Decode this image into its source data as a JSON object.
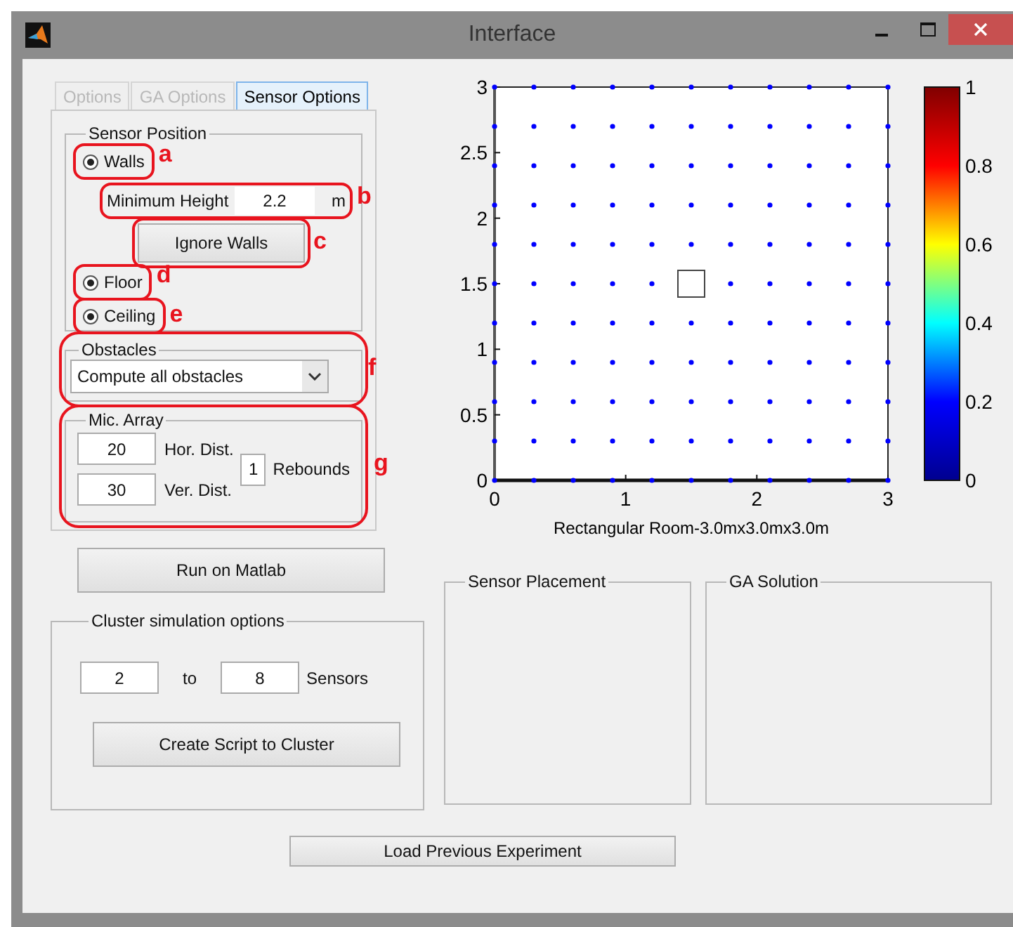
{
  "window": {
    "title": "Interface"
  },
  "tabs": [
    {
      "label": "Options",
      "selected": false,
      "disabled": true
    },
    {
      "label": "GA Options",
      "selected": false,
      "disabled": true
    },
    {
      "label": "Sensor Options",
      "selected": true,
      "disabled": false
    }
  ],
  "sensor_position": {
    "title": "Sensor Position",
    "walls": {
      "label": "Walls",
      "selected": true,
      "annotation": "a"
    },
    "minimum_height": {
      "label": "Minimum Height",
      "value": "2.2",
      "unit": "m",
      "annotation": "b"
    },
    "ignore_walls": {
      "label": "Ignore Walls",
      "annotation": "c"
    },
    "floor": {
      "label": "Floor",
      "selected": true,
      "annotation": "d"
    },
    "ceiling": {
      "label": "Ceiling",
      "selected": true,
      "annotation": "e"
    }
  },
  "obstacles": {
    "title": "Obstacles",
    "value": "Compute all obstacles",
    "annotation": "f"
  },
  "mic_array": {
    "title": "Mic. Array",
    "annotation": "g",
    "horizontal": {
      "value": "20",
      "label": "Hor. Dist."
    },
    "vertical": {
      "value": "30",
      "label": "Ver. Dist."
    },
    "rebounds": {
      "value": "1",
      "label": "Rebounds"
    }
  },
  "run_button": "Run on Matlab",
  "cluster": {
    "title": "Cluster simulation options",
    "from": "2",
    "to_label": "to",
    "to": "8",
    "unit": "Sensors",
    "button": "Create Script to Cluster"
  },
  "plot": {
    "chart_data": {
      "type": "scatter",
      "xlabel": "Rectangular Room-3.0mx3.0mx3.0m",
      "xlim": [
        0,
        3
      ],
      "ylim": [
        0,
        3
      ],
      "xticks": [
        0,
        1,
        2,
        3
      ],
      "yticks": [
        0,
        0.5,
        1,
        1.5,
        2,
        2.5,
        3
      ],
      "x": [
        0,
        0.3,
        0.6,
        0.9,
        1.2,
        1.5,
        1.8,
        2.1,
        2.4,
        2.7,
        3,
        0,
        0.3,
        0.6,
        0.9,
        1.2,
        1.5,
        1.8,
        2.1,
        2.4,
        2.7,
        3,
        0,
        0.3,
        0.6,
        0.9,
        1.2,
        1.5,
        1.8,
        2.1,
        2.4,
        2.7,
        3,
        0,
        0.3,
        0.6,
        0.9,
        1.2,
        1.5,
        1.8,
        2.1,
        2.4,
        2.7,
        3,
        0,
        0.3,
        0.6,
        0.9,
        1.2,
        1.5,
        1.8,
        2.1,
        2.4,
        2.7,
        3,
        0,
        0.3,
        0.6,
        0.9,
        1.2,
        1.8,
        2.1,
        2.4,
        2.7,
        3,
        0,
        0.3,
        0.6,
        0.9,
        1.2,
        1.5,
        1.8,
        2.1,
        2.4,
        2.7,
        3,
        0,
        0.3,
        0.6,
        0.9,
        1.2,
        1.5,
        1.8,
        2.1,
        2.4,
        2.7,
        3,
        0,
        0.3,
        0.6,
        0.9,
        1.2,
        1.5,
        1.8,
        2.1,
        2.4,
        2.7,
        3,
        0,
        0.3,
        0.6,
        0.9,
        1.2,
        1.5,
        1.8,
        2.1,
        2.4,
        2.7,
        3,
        0,
        0.3,
        0.6,
        0.9,
        1.2,
        1.5,
        1.8,
        2.1,
        2.4,
        2.7,
        3
      ],
      "series": [
        {
          "color": "#0000ff",
          "values": [
            0,
            0,
            0,
            0,
            0,
            0,
            0,
            0,
            0,
            0,
            0,
            0.3,
            0.3,
            0.3,
            0.3,
            0.3,
            0.3,
            0.3,
            0.3,
            0.3,
            0.3,
            0.3,
            0.6,
            0.6,
            0.6,
            0.6,
            0.6,
            0.6,
            0.6,
            0.6,
            0.6,
            0.6,
            0.6,
            0.9,
            0.9,
            0.9,
            0.9,
            0.9,
            0.9,
            0.9,
            0.9,
            0.9,
            0.9,
            0.9,
            1.2,
            1.2,
            1.2,
            1.2,
            1.2,
            1.2,
            1.2,
            1.2,
            1.2,
            1.2,
            1.2,
            1.5,
            1.5,
            1.5,
            1.5,
            1.5,
            1.5,
            1.5,
            1.5,
            1.5,
            1.5,
            1.8,
            1.8,
            1.8,
            1.8,
            1.8,
            1.8,
            1.8,
            1.8,
            1.8,
            1.8,
            1.8,
            2.1,
            2.1,
            2.1,
            2.1,
            2.1,
            2.1,
            2.1,
            2.1,
            2.1,
            2.1,
            2.1,
            2.4,
            2.4,
            2.4,
            2.4,
            2.4,
            2.4,
            2.4,
            2.4,
            2.4,
            2.4,
            2.4,
            2.7,
            2.7,
            2.7,
            2.7,
            2.7,
            2.7,
            2.7,
            2.7,
            2.7,
            2.7,
            2.7,
            3,
            3,
            3,
            3,
            3,
            3,
            3,
            3,
            3,
            3,
            3
          ]
        }
      ]
    },
    "colorbar": {
      "ticks": [
        "1",
        "0.8",
        "0.6",
        "0.4",
        "0.2",
        "0"
      ]
    }
  },
  "panels": [
    {
      "title": "Sensor Placement"
    },
    {
      "title": "GA Solution"
    }
  ],
  "load_button": "Load Previous Experiment"
}
